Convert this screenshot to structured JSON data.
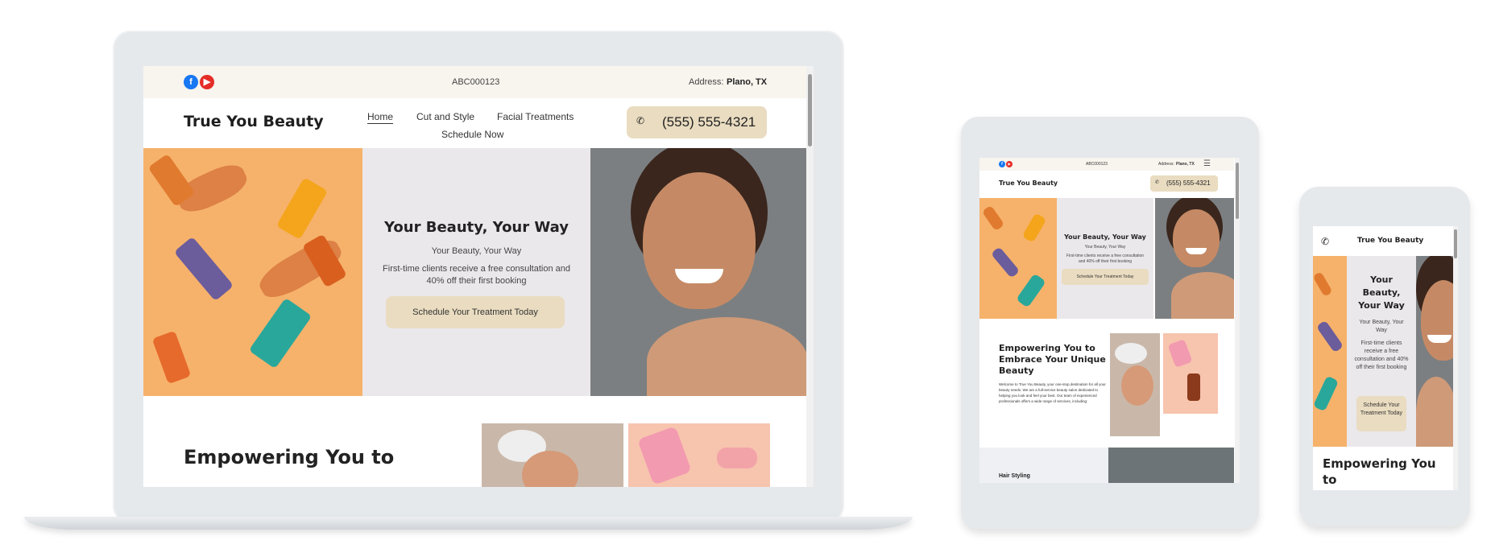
{
  "site": {
    "brand": "True You Beauty",
    "account_id": "ABC000123",
    "address_label": "Address:",
    "address_value": "Plano, TX",
    "phone": "(555) 555-4321",
    "nav": {
      "home": "Home",
      "cut": "Cut and Style",
      "facial": "Facial Treatments",
      "schedule": "Schedule Now"
    },
    "hero": {
      "title": "Your Beauty, Your Way",
      "subtitle": "Your Beauty, Your Way",
      "text": "First-time clients receive a free consultation and 40% off their first booking",
      "cta": "Schedule Your Treatment Today"
    },
    "section": {
      "title": "Empowering You to Embrace Your Unique Beauty",
      "title_short": "Empowering You to",
      "body": "Welcome to True You Beauty, your one-stop destination for all your beauty needs. We are a full-service beauty salon dedicated to helping you look and feel your best. Our team of experienced professionals offers a wide range of services, including:",
      "service_1": "Hair Styling"
    },
    "phone_view": {
      "hero_title": "Your Beauty, Your Way",
      "section_title": "Empowering You to Embr..."
    }
  },
  "icons": {
    "facebook": "facebook-icon",
    "youtube": "youtube-icon",
    "phone": "phone-icon",
    "menu": "hamburger-menu-icon"
  },
  "colors": {
    "topbar_bg": "#f8f4ee",
    "accent": "#e9dcc0",
    "hero_mid_bg": "#ebe8ec",
    "facebook": "#1877f2",
    "youtube": "#e52d27"
  }
}
